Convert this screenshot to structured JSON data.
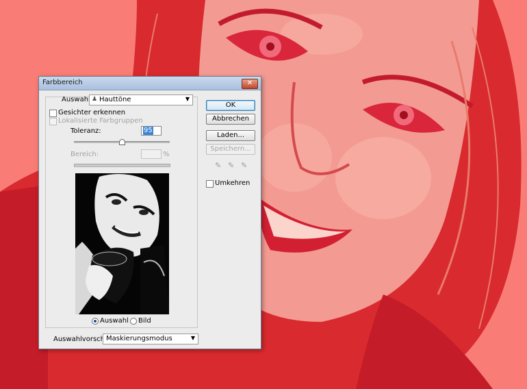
{
  "dialog": {
    "title": "Farbbereich",
    "close_symbol": "✕",
    "selection": {
      "label": "Auswahl:",
      "value": "Hauttöne"
    },
    "detect_faces": {
      "label": "Gesichter erkennen",
      "checked": false
    },
    "localized_color_clusters": {
      "label": "Lokalisierte Farbgruppen",
      "checked": false,
      "enabled": false
    },
    "fuzziness": {
      "label": "Toleranz:",
      "value": "95",
      "slider_level": 0.5
    },
    "range": {
      "label": "Bereich:",
      "value": "",
      "unit": "%",
      "enabled": false
    },
    "preview_mode": {
      "options": [
        {
          "label": "Auswahl",
          "selected": true
        },
        {
          "label": "Bild",
          "selected": false
        }
      ]
    },
    "selection_preview": {
      "label": "Auswahlvorschau:",
      "value": "Maskierungsmodus"
    },
    "buttons": {
      "ok": "OK",
      "cancel": "Abbrechen",
      "load": "Laden...",
      "save": "Speichern..."
    },
    "eyedroppers": [
      "eyedropper-icon",
      "eyedropper-plus-icon",
      "eyedropper-minus-icon"
    ],
    "invert": {
      "label": "Umkehren",
      "checked": false
    }
  },
  "colors": {
    "mask_overlay": "#f97d76",
    "mask_deep": "#d2222a",
    "dialog_bg": "#ececec"
  }
}
